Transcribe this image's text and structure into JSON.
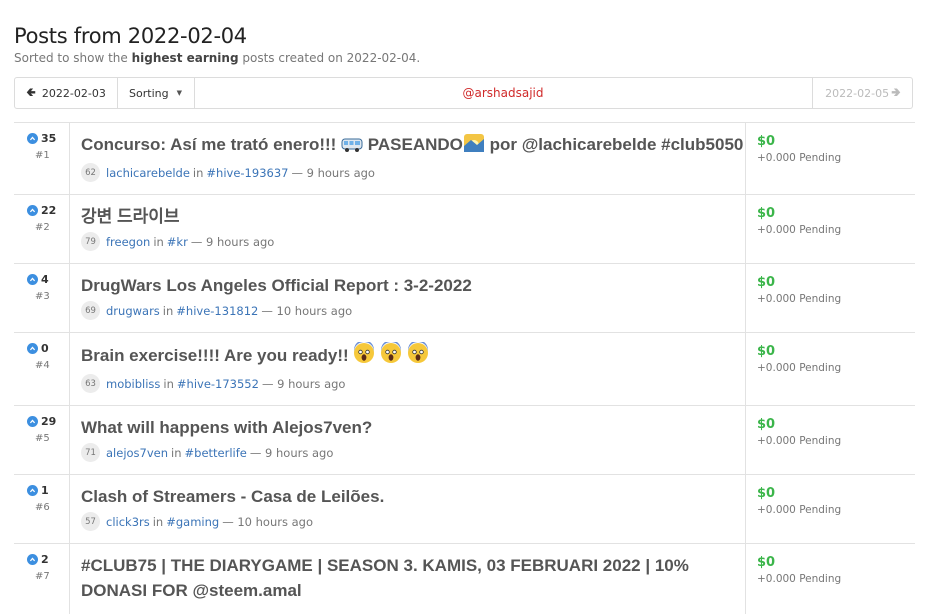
{
  "header": {
    "title": "Posts from 2022-02-04",
    "subtitle_pre": "Sorted to show the",
    "subtitle_bold": "highest earning",
    "subtitle_post": "posts created on 2022-02-04."
  },
  "toolbar": {
    "prev_label": "2022-02-03",
    "sort_label": "Sorting",
    "user_label": "@arshadsajid",
    "next_label": "2022-02-05"
  },
  "posts": [
    {
      "votes": "35",
      "rank": "#1",
      "title_a": "Concurso: Así me trató enero!!! ",
      "title_b": " PASEANDO",
      "title_c": " por @lachicarebelde #club5050",
      "rep": "62",
      "author": "lachicarebelde",
      "in": "in",
      "community": "#hive-193637",
      "time": "— 9 hours ago",
      "earnings": "$0",
      "pending": "+0.000 Pending"
    },
    {
      "votes": "22",
      "rank": "#2",
      "title": "강변 드라이브",
      "rep": "79",
      "author": "freegon",
      "in": "in",
      "community": "#kr",
      "time": "— 9 hours ago",
      "earnings": "$0",
      "pending": "+0.000 Pending"
    },
    {
      "votes": "4",
      "rank": "#3",
      "title": "DrugWars Los Angeles Official Report : 3-2-2022",
      "rep": "69",
      "author": "drugwars",
      "in": "in",
      "community": "#hive-131812",
      "time": "— 10 hours ago",
      "earnings": "$0",
      "pending": "+0.000 Pending"
    },
    {
      "votes": "0",
      "rank": "#4",
      "title": "Brain exercise!!!! Are you ready!!",
      "rep": "63",
      "author": "mobibliss",
      "in": "in",
      "community": "#hive-173552",
      "time": "— 9 hours ago",
      "earnings": "$0",
      "pending": "+0.000 Pending"
    },
    {
      "votes": "29",
      "rank": "#5",
      "title": "What will happens with Alejos7ven?",
      "rep": "71",
      "author": "alejos7ven",
      "in": "in",
      "community": "#betterlife",
      "time": "— 9 hours ago",
      "earnings": "$0",
      "pending": "+0.000 Pending"
    },
    {
      "votes": "1",
      "rank": "#6",
      "title": "Clash of Streamers - Casa de Leilões.",
      "rep": "57",
      "author": "click3rs",
      "in": "in",
      "community": "#gaming",
      "time": "— 10 hours ago",
      "earnings": "$0",
      "pending": "+0.000 Pending"
    },
    {
      "votes": "2",
      "rank": "#7",
      "title": "#CLUB75 | THE DIARYGAME | SEASON 3. KAMIS, 03 FEBRUARI 2022 | 10% DONASI FOR @steem.amal",
      "earnings": "$0",
      "pending": "+0.000 Pending"
    }
  ],
  "icons": {
    "vote": "upvote-chevron-icon",
    "prev": "arrow-left-icon",
    "next": "arrow-right-icon",
    "sort": "caret-down-icon",
    "emoji_bus": "minibus-emoji-icon",
    "emoji_sunrise": "sunrise-emoji-icon",
    "emoji_scream": "face-screaming-emoji-icon"
  },
  "colors": {
    "accent": "#3b74b7",
    "earnings": "#3bb54a",
    "user": "#d02a2a",
    "vote": "#3c8fe0"
  }
}
